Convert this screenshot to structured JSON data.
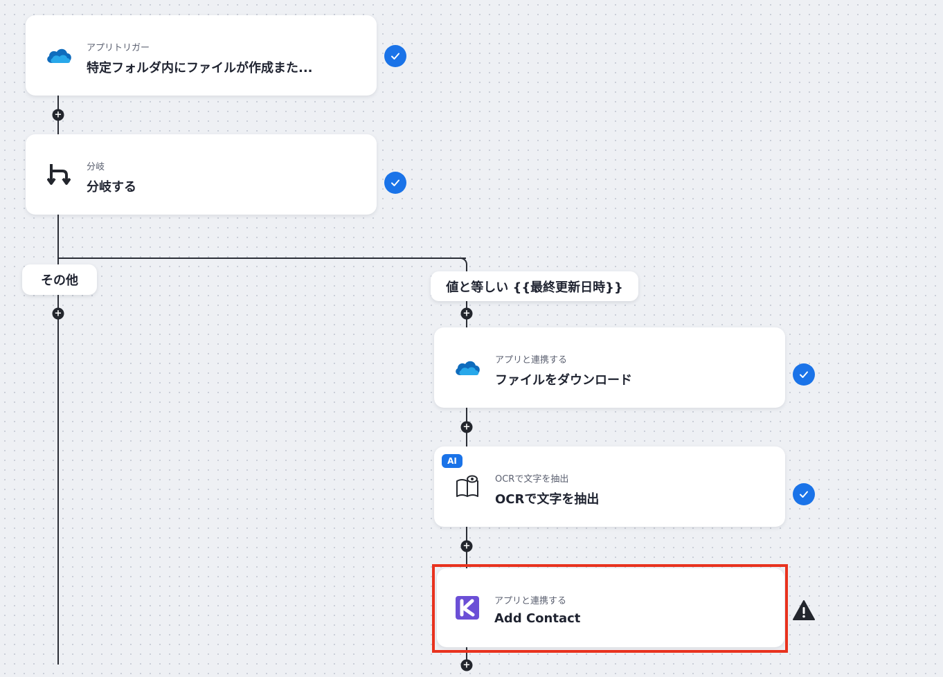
{
  "flow": {
    "trigger": {
      "subtitle": "アプリトリガー",
      "title": "特定フォルダ内にファイルが作成また..."
    },
    "branch": {
      "subtitle": "分岐",
      "title": "分岐する"
    },
    "branch_else_label": "その他",
    "branch_condition_label": "値と等しい {{最終更新日時}}",
    "download": {
      "subtitle": "アプリと連携する",
      "title": "ファイルをダウンロード"
    },
    "ocr": {
      "subtitle": "OCRで文字を抽出",
      "title": "OCRで文字を抽出",
      "badge": "AI"
    },
    "add_contact": {
      "subtitle": "アプリと連携する",
      "title": "Add Contact"
    },
    "plus_symbol": "+"
  },
  "colors": {
    "check_blue": "#1a73e8",
    "highlight_red": "#e8321e",
    "kintone_purple": "#6b4fd6",
    "onedrive_blue": "#1b7fd9"
  },
  "icons": {
    "trigger": "onedrive-cloud-icon",
    "branch": "branch-icon",
    "download": "onedrive-cloud-icon",
    "ocr": "ocr-book-eye-icon",
    "add_contact": "k-logo-icon",
    "status_ok": "checkmark-icon",
    "status_warn": "warning-triangle-icon"
  }
}
